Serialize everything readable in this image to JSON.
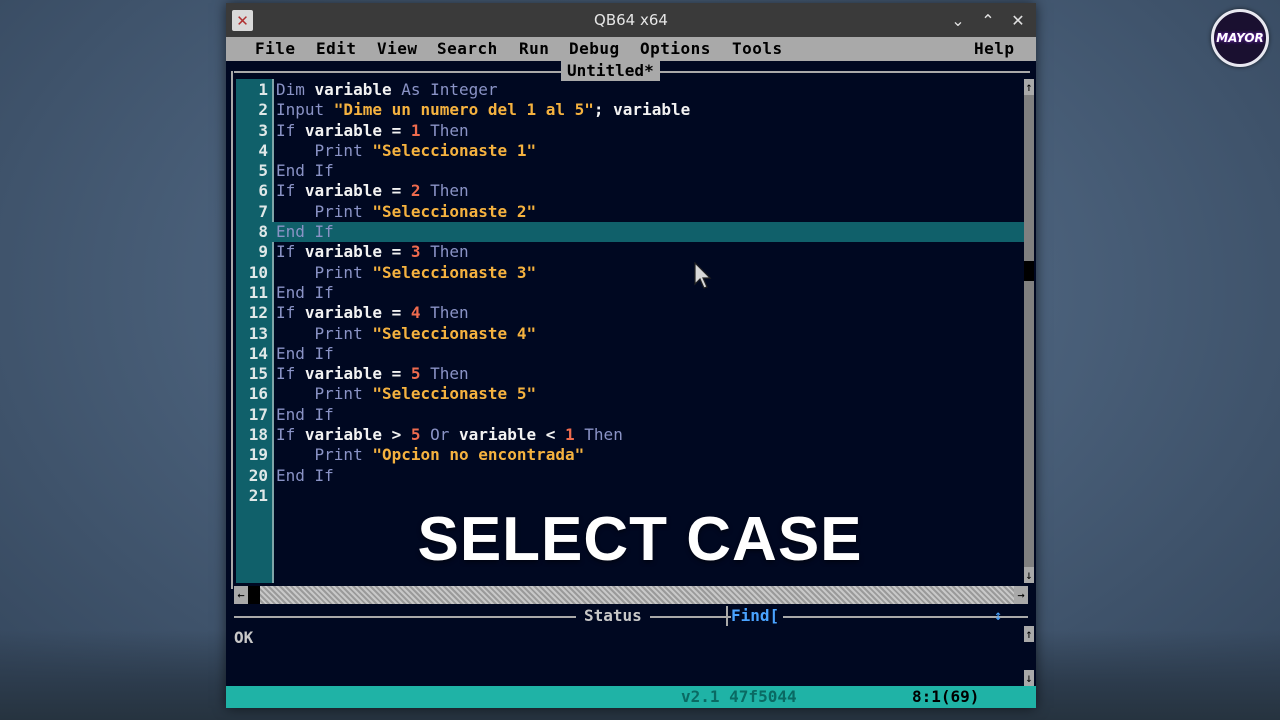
{
  "window": {
    "title": "QB64 x64"
  },
  "menu": [
    "File",
    "Edit",
    "View",
    "Search",
    "Run",
    "Debug",
    "Options",
    "Tools",
    "Help"
  ],
  "document": {
    "title": "Untitled*"
  },
  "code_lines": [
    {
      "n": "1",
      "tokens": [
        [
          "kw",
          "Dim "
        ],
        [
          "id",
          "variable "
        ],
        [
          "kw",
          "As Integer"
        ]
      ]
    },
    {
      "n": "2",
      "tokens": [
        [
          "kw",
          "Input "
        ],
        [
          "str",
          "\"Dime un numero del 1 al 5\""
        ],
        [
          "id",
          "; variable"
        ]
      ]
    },
    {
      "n": "3",
      "tokens": [
        [
          "kw",
          "If "
        ],
        [
          "id",
          "variable = "
        ],
        [
          "num",
          "1"
        ],
        [
          "kw",
          " Then"
        ]
      ]
    },
    {
      "n": "4",
      "tokens": [
        [
          "kw",
          "    Print "
        ],
        [
          "str",
          "\"Seleccionaste 1\""
        ]
      ]
    },
    {
      "n": "5",
      "tokens": [
        [
          "kw",
          "End If"
        ]
      ]
    },
    {
      "n": "6",
      "tokens": [
        [
          "kw",
          "If "
        ],
        [
          "id",
          "variable = "
        ],
        [
          "num",
          "2"
        ],
        [
          "kw",
          " Then"
        ]
      ]
    },
    {
      "n": "7",
      "tokens": [
        [
          "kw",
          "    Print "
        ],
        [
          "str",
          "\"Seleccionaste 2\""
        ]
      ]
    },
    {
      "n": "8",
      "tokens": [
        [
          "kw",
          "End If"
        ]
      ],
      "highlight": true
    },
    {
      "n": "9",
      "tokens": [
        [
          "kw",
          "If "
        ],
        [
          "id",
          "variable = "
        ],
        [
          "num",
          "3"
        ],
        [
          "kw",
          " Then"
        ]
      ]
    },
    {
      "n": "10",
      "tokens": [
        [
          "kw",
          "    Print "
        ],
        [
          "str",
          "\"Seleccionaste 3\""
        ]
      ]
    },
    {
      "n": "11",
      "tokens": [
        [
          "kw",
          "End If"
        ]
      ]
    },
    {
      "n": "12",
      "tokens": [
        [
          "kw",
          "If "
        ],
        [
          "id",
          "variable = "
        ],
        [
          "num",
          "4"
        ],
        [
          "kw",
          " Then"
        ]
      ]
    },
    {
      "n": "13",
      "tokens": [
        [
          "kw",
          "    Print "
        ],
        [
          "str",
          "\"Seleccionaste 4\""
        ]
      ]
    },
    {
      "n": "14",
      "tokens": [
        [
          "kw",
          "End If"
        ]
      ]
    },
    {
      "n": "15",
      "tokens": [
        [
          "kw",
          "If "
        ],
        [
          "id",
          "variable = "
        ],
        [
          "num",
          "5"
        ],
        [
          "kw",
          " Then"
        ]
      ]
    },
    {
      "n": "16",
      "tokens": [
        [
          "kw",
          "    Print "
        ],
        [
          "str",
          "\"Seleccionaste 5\""
        ]
      ]
    },
    {
      "n": "17",
      "tokens": [
        [
          "kw",
          "End If"
        ]
      ]
    },
    {
      "n": "18",
      "tokens": [
        [
          "kw",
          "If "
        ],
        [
          "id",
          "variable > "
        ],
        [
          "num",
          "5"
        ],
        [
          "kw",
          " Or "
        ],
        [
          "id",
          "variable < "
        ],
        [
          "num",
          "1"
        ],
        [
          "kw",
          " Then"
        ]
      ]
    },
    {
      "n": "19",
      "tokens": [
        [
          "kw",
          "    Print "
        ],
        [
          "str",
          "\"Opcion no encontrada\""
        ]
      ]
    },
    {
      "n": "20",
      "tokens": [
        [
          "kw",
          "End If"
        ]
      ]
    },
    {
      "n": "21",
      "tokens": []
    }
  ],
  "overlay_caption": "SELECT CASE",
  "status": {
    "label": "Status",
    "find_label": "Find[",
    "message": "OK"
  },
  "footer": {
    "version": "v2.1 47f5044",
    "position": "8:1(69)"
  },
  "channel_logo": {
    "text": "MAYOR"
  },
  "colors": {
    "editor_bg": "#000821",
    "keyword": "#8a93c6",
    "string": "#f5b23f",
    "number": "#ef6b4e",
    "footer": "#1fb3a6"
  }
}
